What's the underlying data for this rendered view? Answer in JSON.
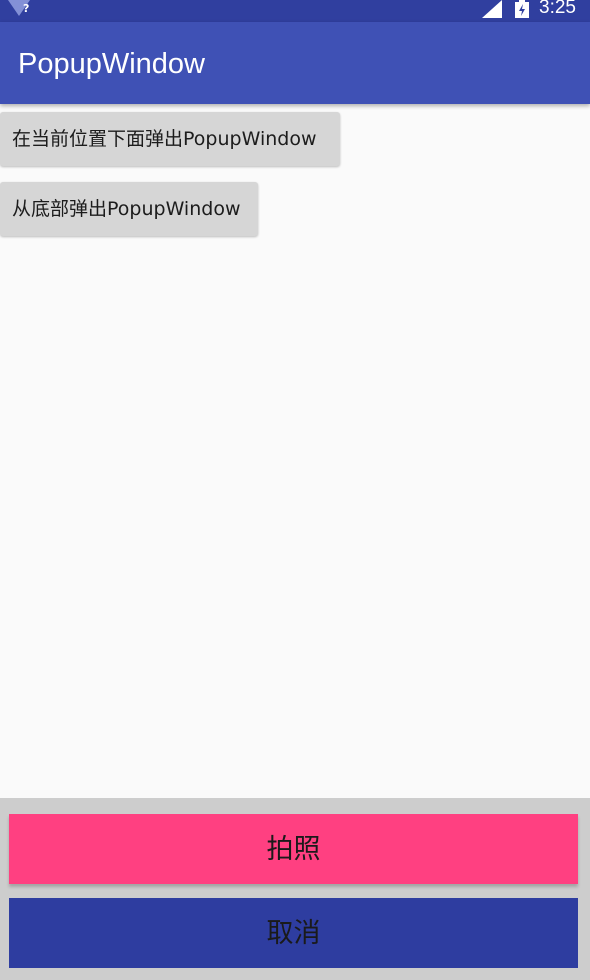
{
  "status_bar": {
    "time": "3:25",
    "wifi_icon": "wifi-unknown-icon",
    "wifi_badge": "?",
    "signal_icon": "signal-icon",
    "battery_icon": "battery-charging-icon",
    "background_color": "#303f9f"
  },
  "app_bar": {
    "title": "PopupWindow",
    "background_color": "#3f51b5"
  },
  "buttons": {
    "show_below": "在当前位置下面弹出PopupWindow",
    "show_bottom": "从底部弹出PopupWindow"
  },
  "popup": {
    "take_photo": "拍照",
    "cancel": "取消",
    "take_photo_color": "#ff4081",
    "cancel_color": "#2e3da0"
  }
}
